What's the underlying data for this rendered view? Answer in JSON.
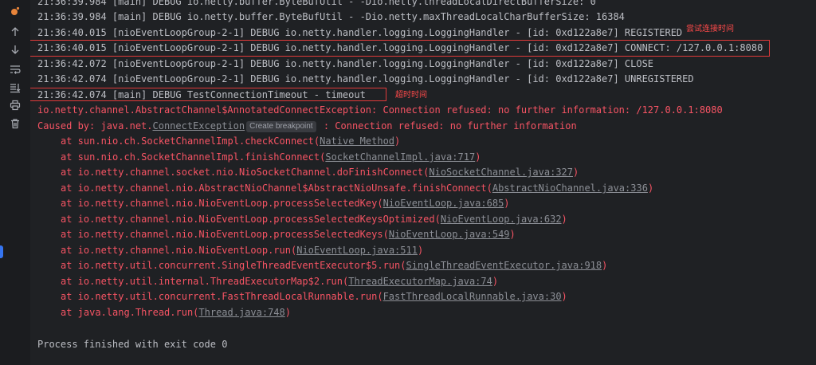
{
  "toolbar": {
    "icons": [
      "run-icon",
      "scroll-up-icon",
      "scroll-down-icon",
      "soft-wrap-icon",
      "scroll-to-end-icon",
      "print-icon",
      "trash-icon"
    ]
  },
  "console": {
    "log_lines": [
      "21:36:39.984 [main] DEBUG io.netty.buffer.ByteBufUtil - -Dio.netty.threadLocalDirectBufferSize: 0",
      "21:36:39.984 [main] DEBUG io.netty.buffer.ByteBufUtil - -Dio.netty.maxThreadLocalCharBufferSize: 16384",
      "21:36:40.015 [nioEventLoopGroup-2-1] DEBUG io.netty.handler.logging.LoggingHandler - [id: 0xd122a8e7] REGISTERED",
      "21:36:40.015 [nioEventLoopGroup-2-1] DEBUG io.netty.handler.logging.LoggingHandler - [id: 0xd122a8e7] CONNECT: /127.0.0.1:8080",
      "21:36:42.072 [nioEventLoopGroup-2-1] DEBUG io.netty.handler.logging.LoggingHandler - [id: 0xd122a8e7] CLOSE",
      "21:36:42.074 [nioEventLoopGroup-2-1] DEBUG io.netty.handler.logging.LoggingHandler - [id: 0xd122a8e7] UNREGISTERED",
      "21:36:42.074 [main] DEBUG TestConnectionTimeout - timeout"
    ],
    "exception_line": "io.netty.channel.AbstractChannel$AnnotatedConnectException: Connection refused: no further information: /127.0.0.1:8080",
    "caused_by": {
      "prefix": "Caused by: java.net.",
      "exception": "ConnectException",
      "chip": "Create breakpoint",
      "suffix": " : Connection refused: no further information"
    },
    "stack": [
      {
        "text": "at sun.nio.ch.SocketChannelImpl.checkConnect(",
        "link": "Native Method"
      },
      {
        "text": "at sun.nio.ch.SocketChannelImpl.finishConnect(",
        "link": "SocketChannelImpl.java:717"
      },
      {
        "text": "at io.netty.channel.socket.nio.NioSocketChannel.doFinishConnect(",
        "link": "NioSocketChannel.java:327"
      },
      {
        "text": "at io.netty.channel.nio.AbstractNioChannel$AbstractNioUnsafe.finishConnect(",
        "link": "AbstractNioChannel.java:336"
      },
      {
        "text": "at io.netty.channel.nio.NioEventLoop.processSelectedKey(",
        "link": "NioEventLoop.java:685"
      },
      {
        "text": "at io.netty.channel.nio.NioEventLoop.processSelectedKeysOptimized(",
        "link": "NioEventLoop.java:632"
      },
      {
        "text": "at io.netty.channel.nio.NioEventLoop.processSelectedKeys(",
        "link": "NioEventLoop.java:549"
      },
      {
        "text": "at io.netty.channel.nio.NioEventLoop.run(",
        "link": "NioEventLoop.java:511"
      },
      {
        "text": "at io.netty.util.concurrent.SingleThreadEventExecutor$5.run(",
        "link": "SingleThreadEventExecutor.java:918"
      },
      {
        "text": "at io.netty.util.internal.ThreadExecutorMap$2.run(",
        "link": "ThreadExecutorMap.java:74"
      },
      {
        "text": "at io.netty.util.concurrent.FastThreadLocalRunnable.run(",
        "link": "FastThreadLocalRunnable.java:30"
      },
      {
        "text": "at java.lang.Thread.run(",
        "link": "Thread.java:748"
      }
    ],
    "close_paren": ")",
    "exit_line": "Process finished with exit code 0"
  },
  "annotations": {
    "connect_note": "尝试连接时间",
    "timeout_note": "超时时间"
  },
  "colors": {
    "error": "#f75464",
    "annotation": "#e03a3a",
    "accent": "#3574f0"
  }
}
